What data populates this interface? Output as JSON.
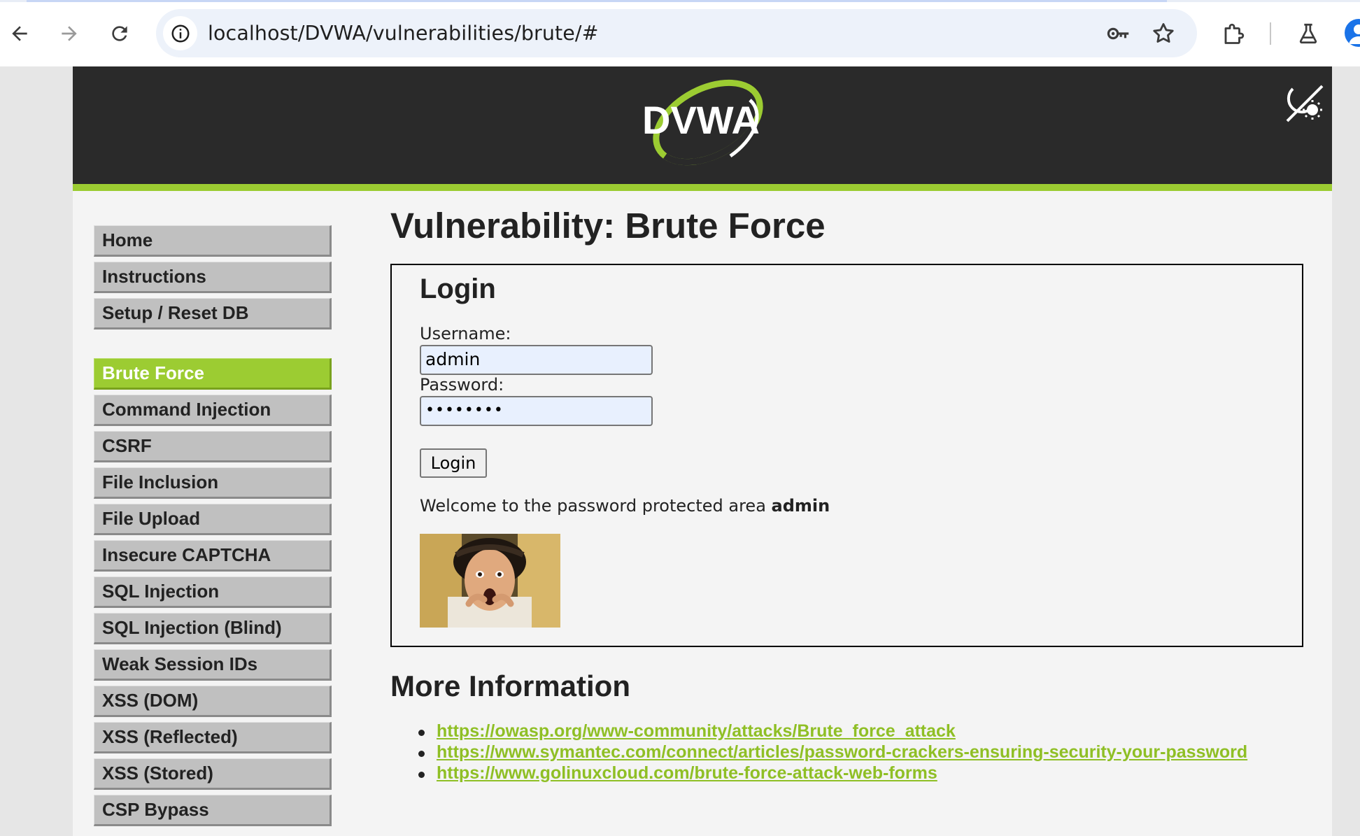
{
  "browser": {
    "url": "localhost/DVWA/vulnerabilities/brute/#",
    "icons": [
      "back-icon",
      "forward-icon",
      "reload-icon",
      "site-info-icon",
      "password-key-icon",
      "bookmark-star-icon",
      "extensions-icon",
      "labs-flask-icon",
      "profile-avatar-icon"
    ]
  },
  "header": {
    "logo_text": "DVWA",
    "theme_toggle_icon": "moon-sun-toggle-icon",
    "accent_color": "#9ccc32"
  },
  "sidebar": {
    "group1": [
      {
        "label": "Home"
      },
      {
        "label": "Instructions"
      },
      {
        "label": "Setup / Reset DB"
      }
    ],
    "group2": [
      {
        "label": "Brute Force",
        "selected": true
      },
      {
        "label": "Command Injection"
      },
      {
        "label": "CSRF"
      },
      {
        "label": "File Inclusion"
      },
      {
        "label": "File Upload"
      },
      {
        "label": "Insecure CAPTCHA"
      },
      {
        "label": "SQL Injection"
      },
      {
        "label": "SQL Injection (Blind)"
      },
      {
        "label": "Weak Session IDs"
      },
      {
        "label": "XSS (DOM)"
      },
      {
        "label": "XSS (Reflected)"
      },
      {
        "label": "XSS (Stored)"
      },
      {
        "label": "CSP Bypass"
      }
    ]
  },
  "main": {
    "title": "Vulnerability: Brute Force",
    "login": {
      "heading": "Login",
      "username_label": "Username:",
      "username_value": "admin",
      "password_label": "Password:",
      "password_value": "••••••••",
      "button_label": "Login",
      "welcome_text": "Welcome to the password protected area ",
      "welcome_user": "admin"
    },
    "more_info": {
      "heading": "More Information",
      "links": [
        "https://owasp.org/www-community/attacks/Brute_force_attack",
        "https://www.symantec.com/connect/articles/password-crackers-ensuring-security-your-password",
        "https://www.golinuxcloud.com/brute-force-attack-web-forms"
      ]
    }
  }
}
